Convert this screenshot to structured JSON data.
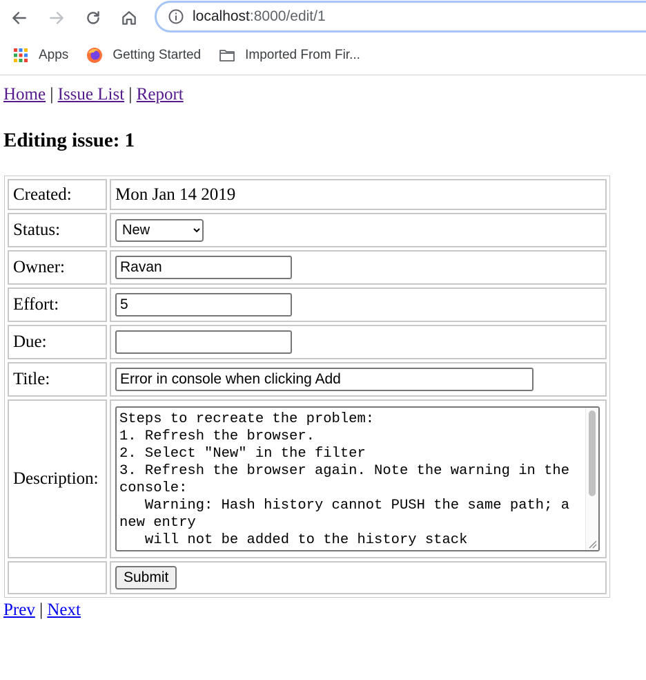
{
  "browser": {
    "url_host": "localhost",
    "url_path": ":8000/edit/1",
    "bookmarks": [
      {
        "label": "Apps",
        "icon": "apps-grid-icon"
      },
      {
        "label": "Getting Started",
        "icon": "firefox-icon"
      },
      {
        "label": "Imported From Fir...",
        "icon": "folder-icon"
      }
    ]
  },
  "nav": {
    "home": "Home",
    "issue_list": "Issue List",
    "report": "Report",
    "sep": "|"
  },
  "page_title": "Editing issue: 1",
  "form": {
    "created_label": "Created:",
    "created_value": "Mon Jan 14 2019",
    "status_label": "Status:",
    "status_value": "New",
    "owner_label": "Owner:",
    "owner_value": "Ravan",
    "effort_label": "Effort:",
    "effort_value": "5",
    "due_label": "Due:",
    "due_value": "",
    "title_label": "Title:",
    "title_value": "Error in console when clicking Add",
    "description_label": "Description:",
    "description_value": "Steps to recreate the problem:\n1. Refresh the browser.\n2. Select \"New\" in the filter\n3. Refresh the browser again. Note the warning in the console:\n   Warning: Hash history cannot PUSH the same path; a new entry\n   will not be added to the history stack",
    "submit_label": "Submit"
  },
  "pager": {
    "prev": "Prev",
    "next": "Next",
    "sep": "|"
  },
  "colors": {
    "visited_link": "#551a8b",
    "link": "#0000ee",
    "omnibox_focus": "#a7c6f5"
  }
}
